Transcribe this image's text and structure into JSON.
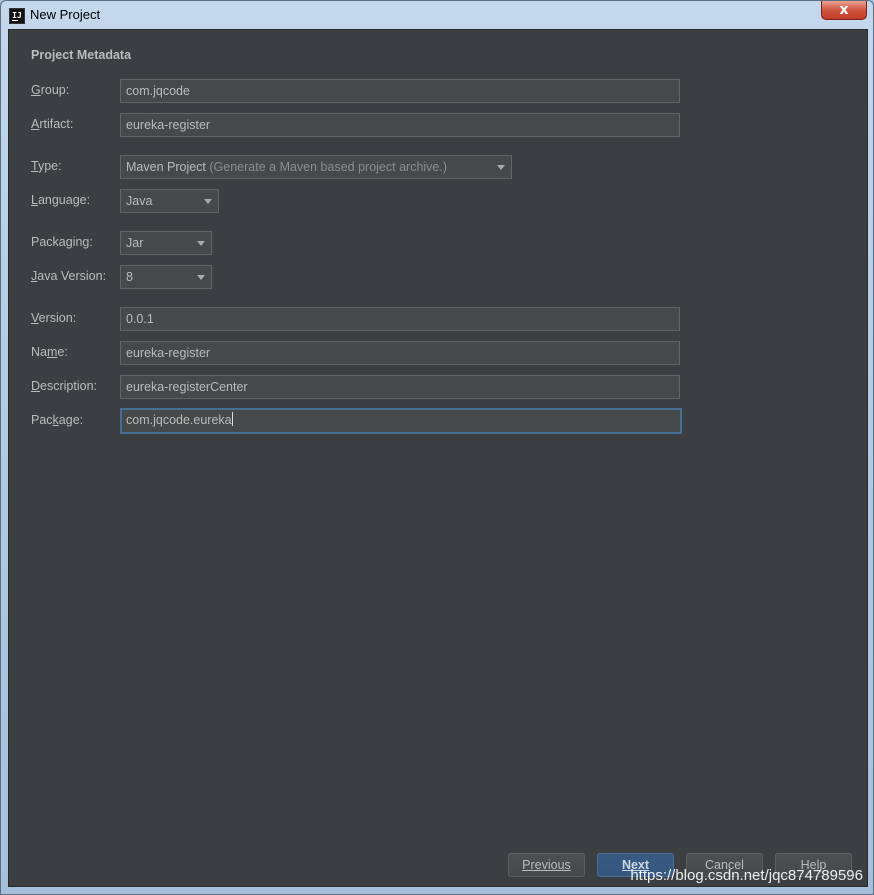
{
  "window": {
    "title": "New Project",
    "close_label": "x"
  },
  "section_title": "Project Metadata",
  "fields": {
    "group": {
      "label_pre": "",
      "label_key": "G",
      "label_post": "roup:",
      "value": "com.jqcode"
    },
    "artifact": {
      "label_pre": "",
      "label_key": "A",
      "label_post": "rtifact:",
      "value": "eureka-register"
    },
    "type": {
      "label_pre": "",
      "label_key": "T",
      "label_post": "ype:",
      "value": "Maven Project",
      "hint": "(Generate a Maven based project archive.)"
    },
    "language": {
      "label_pre": "",
      "label_key": "L",
      "label_post": "anguage:",
      "value": "Java"
    },
    "packaging": {
      "label_pre": "Packa",
      "label_key": "g",
      "label_post": "ing:",
      "value": "Jar"
    },
    "java_version": {
      "label_pre": "",
      "label_key": "J",
      "label_post": "ava Version:",
      "value": "8"
    },
    "version": {
      "label_pre": "",
      "label_key": "V",
      "label_post": "ersion:",
      "value": "0.0.1"
    },
    "name": {
      "label_pre": "Na",
      "label_key": "m",
      "label_post": "e:",
      "value": "eureka-register"
    },
    "description": {
      "label_pre": "",
      "label_key": "D",
      "label_post": "escription:",
      "value": "eureka-registerCenter"
    },
    "package": {
      "label_pre": "Pac",
      "label_key": "k",
      "label_post": "age:",
      "value": "com.jqcode.eureka"
    }
  },
  "buttons": {
    "previous": "Previous",
    "next": "Next",
    "cancel": "Cancel",
    "help": "Help"
  },
  "watermark": "https://blog.csdn.net/jqc874789596",
  "colors": {
    "background": "#3c3f41",
    "text": "#bbbbbb",
    "focus": "#466d94",
    "primary_button": "#365880"
  }
}
